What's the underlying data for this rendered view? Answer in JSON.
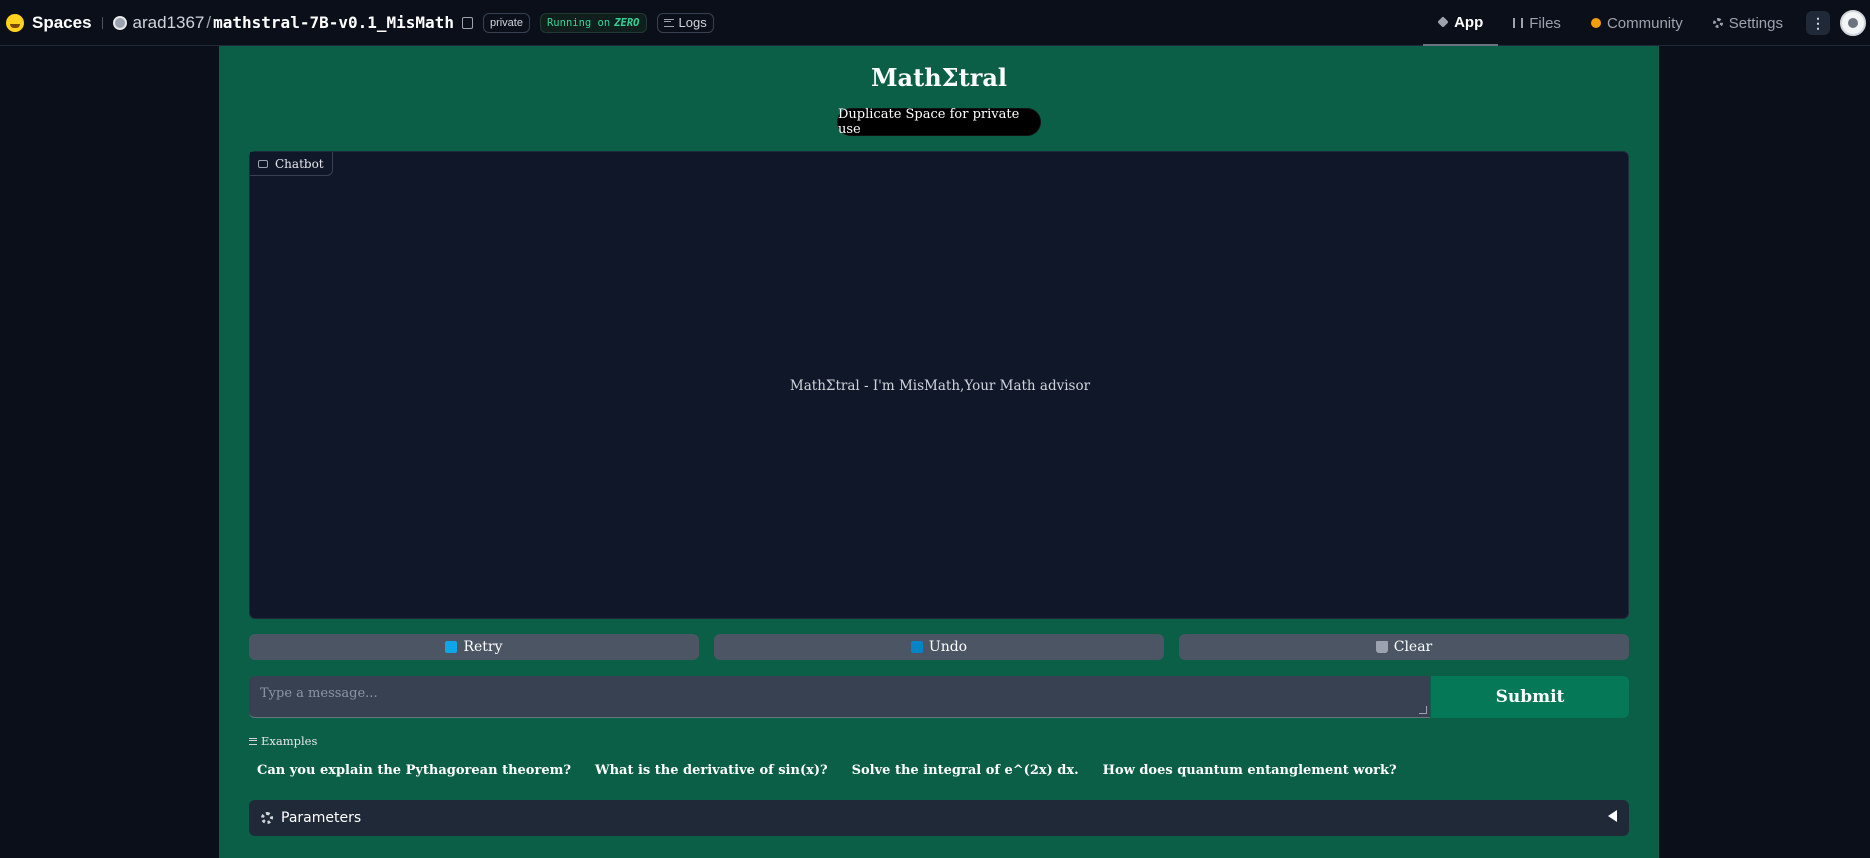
{
  "topbar": {
    "brand": "Spaces",
    "owner": "arad1367",
    "slash": "/",
    "repo_name": "mathstral-7B-v0.1_MisMath",
    "visibility": "private",
    "running_prefix": "Running on",
    "running_hw": "ZERO",
    "logs": "Logs",
    "nav": {
      "app": "App",
      "files": "Files",
      "community": "Community",
      "settings": "Settings"
    },
    "more": "⋮"
  },
  "app": {
    "title": "MathΣtral",
    "duplicate_label": "Duplicate Space for private use",
    "chatbot_label": "Chatbot",
    "chatbot_placeholder": "MathΣtral - I'm MisMath,Your Math advisor",
    "retry_label": "Retry",
    "undo_label": "Undo",
    "clear_label": "Clear",
    "input_placeholder": "Type a message...",
    "input_value": "",
    "submit_label": "Submit",
    "examples_label": "Examples",
    "examples": [
      "Can you explain the Pythagorean theorem?",
      "What is the derivative of sin(x)?",
      "Solve the integral of e^(2x) dx.",
      "How does quantum entanglement work?"
    ],
    "parameters_label": "Parameters"
  },
  "colors": {
    "page_bg": "#0b0f19",
    "app_bg": "#0c5f47",
    "chatbot_bg": "#101729",
    "submit_bg": "#047857",
    "action_btn_bg": "#4b5563"
  }
}
